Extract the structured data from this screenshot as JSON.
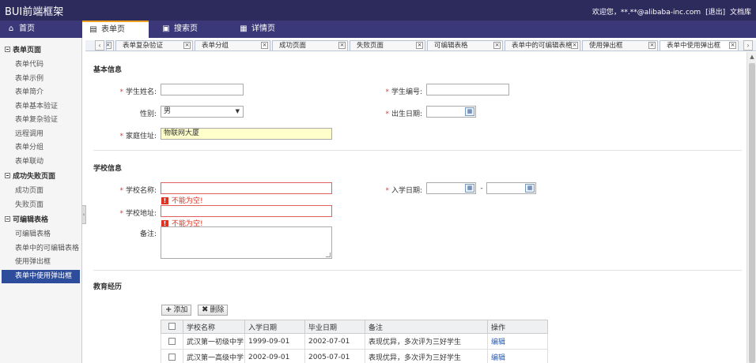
{
  "header": {
    "logo": "BUI前端框架",
    "welcome": "欢迎您，**.**@alibaba-inc.com",
    "logout": "[退出]",
    "docs": "文档库"
  },
  "mainnav": [
    {
      "label": "首页",
      "icon": "home-icon"
    },
    {
      "label": "表单页",
      "icon": "form-icon"
    },
    {
      "label": "搜索页",
      "icon": "search-page-icon"
    },
    {
      "label": "详情页",
      "icon": "detail-icon"
    }
  ],
  "sidebar": {
    "groups": [
      {
        "title": "表单页面",
        "items": [
          "表单代码",
          "表单示例",
          "表单简介",
          "表单基本验证",
          "表单复杂验证",
          "远程调用",
          "表单分组",
          "表单联动"
        ]
      },
      {
        "title": "成功失败页面",
        "items": [
          "成功页面",
          "失败页面"
        ]
      },
      {
        "title": "可编辑表格",
        "items": [
          "可编辑表格",
          "表单中的可编辑表格",
          "使用弹出框",
          "表单中使用弹出框"
        ]
      }
    ]
  },
  "pagetabs": [
    "表单复杂验证",
    "表单分组",
    "成功页面",
    "失败页面",
    "可编辑表格",
    "表单中的可编辑表格",
    "使用弹出框",
    "表单中使用弹出框"
  ],
  "form": {
    "basic_title": "基本信息",
    "student_name_label": "学生姓名:",
    "student_id_label": "学生编号:",
    "gender_label": "性别:",
    "gender_value": "男",
    "birth_label": "出生日期:",
    "address_label": "家庭住址:",
    "address_value": "物联网大厦",
    "school_title": "学校信息",
    "school_name_label": "学校名称:",
    "enroll_label": "入学日期:",
    "range_sep": "-",
    "school_addr_label": "学校地址:",
    "error_text": "不能为空!",
    "remark_label": "备注:",
    "edu_title": "教育经历",
    "add_button": "添加",
    "delete_button": "删除"
  },
  "table": {
    "columns": [
      "学校名称",
      "入学日期",
      "毕业日期",
      "备注",
      "操作"
    ],
    "rows": [
      {
        "school": "武汉第一初级中学",
        "start": "1999-09-01",
        "end": "2002-07-01",
        "remark": "表现优异，多次评为三好学生",
        "action": "编辑"
      },
      {
        "school": "武汉第一高级中学",
        "start": "2002-09-01",
        "end": "2005-07-01",
        "remark": "表现优异，多次评为三好学生",
        "action": "编辑"
      }
    ]
  }
}
